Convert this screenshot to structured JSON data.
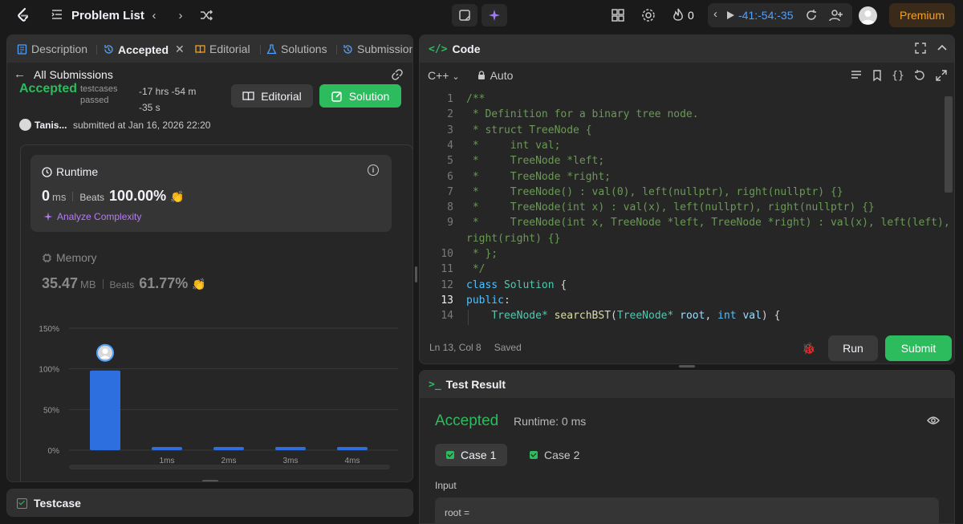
{
  "topnav": {
    "title": "Problem List",
    "streak": "0",
    "timer": "-41:-54:-35",
    "premium": "Premium"
  },
  "left": {
    "tabs": [
      "Description",
      "Accepted",
      "Editorial",
      "Solutions",
      "Submissions"
    ],
    "back_label": "All Submissions",
    "status": "Accepted",
    "testcases_label_1": "testcases",
    "testcases_label_2": "passed",
    "time_line_1": "-17 hrs -54 m",
    "time_line_2": "-35 s",
    "editorial_btn": "Editorial",
    "solution_btn": "Solution",
    "user": "Tanis...",
    "submitted_at": "submitted at Jan 16, 2026 22:20",
    "runtime": {
      "title": "Runtime",
      "value": "0",
      "unit": "ms",
      "beats_label": "Beats",
      "beats": "100.00%",
      "analyze": "Analyze Complexity"
    },
    "memory": {
      "title": "Memory",
      "value": "35.47",
      "unit": "MB",
      "beats_label": "Beats",
      "beats": "61.77%"
    }
  },
  "chart_data": {
    "type": "bar",
    "categories": [
      "",
      "1ms",
      "2ms",
      "3ms",
      "4ms"
    ],
    "values": [
      98,
      4,
      4,
      4,
      4
    ],
    "yticks": [
      "150%",
      "100%",
      "50%",
      "0%"
    ],
    "ylim": [
      0,
      150
    ],
    "grid": true,
    "bar_color": "#2e6fe0"
  },
  "code": {
    "title": "Code",
    "language": "C++",
    "mode": "Auto",
    "current_line": 13,
    "status": "Ln 13, Col 8",
    "saved": "Saved",
    "run": "Run",
    "submit": "Submit",
    "lines": [
      {
        "n": "1",
        "t": "/**"
      },
      {
        "n": "2",
        "t": " * Definition for a binary tree node."
      },
      {
        "n": "3",
        "t": " * struct TreeNode {"
      },
      {
        "n": "4",
        "t": " *     int val;"
      },
      {
        "n": "5",
        "t": " *     TreeNode *left;"
      },
      {
        "n": "6",
        "t": " *     TreeNode *right;"
      },
      {
        "n": "7",
        "t": " *     TreeNode() : val(0), left(nullptr), right(nullptr) {}"
      },
      {
        "n": "8",
        "t": " *     TreeNode(int x) : val(x), left(nullptr), right(nullptr) {}"
      },
      {
        "n": "9",
        "t": " *     TreeNode(int x, TreeNode *left, TreeNode *right) : val(x), left(left),"
      },
      {
        "n": "",
        "t": "right(right) {}"
      },
      {
        "n": "10",
        "t": " * };"
      },
      {
        "n": "11",
        "t": " */"
      },
      {
        "n": "12",
        "t": "class Solution {"
      },
      {
        "n": "13",
        "t": "public:"
      },
      {
        "n": "14",
        "t": "    TreeNode* searchBST(TreeNode* root, int val) {"
      }
    ]
  },
  "result": {
    "title": "Test Result",
    "status": "Accepted",
    "runtime": "Runtime: 0 ms",
    "cases": [
      "Case 1",
      "Case 2"
    ],
    "input_label": "Input",
    "input_value": "root ="
  },
  "testcase": {
    "title": "Testcase"
  }
}
